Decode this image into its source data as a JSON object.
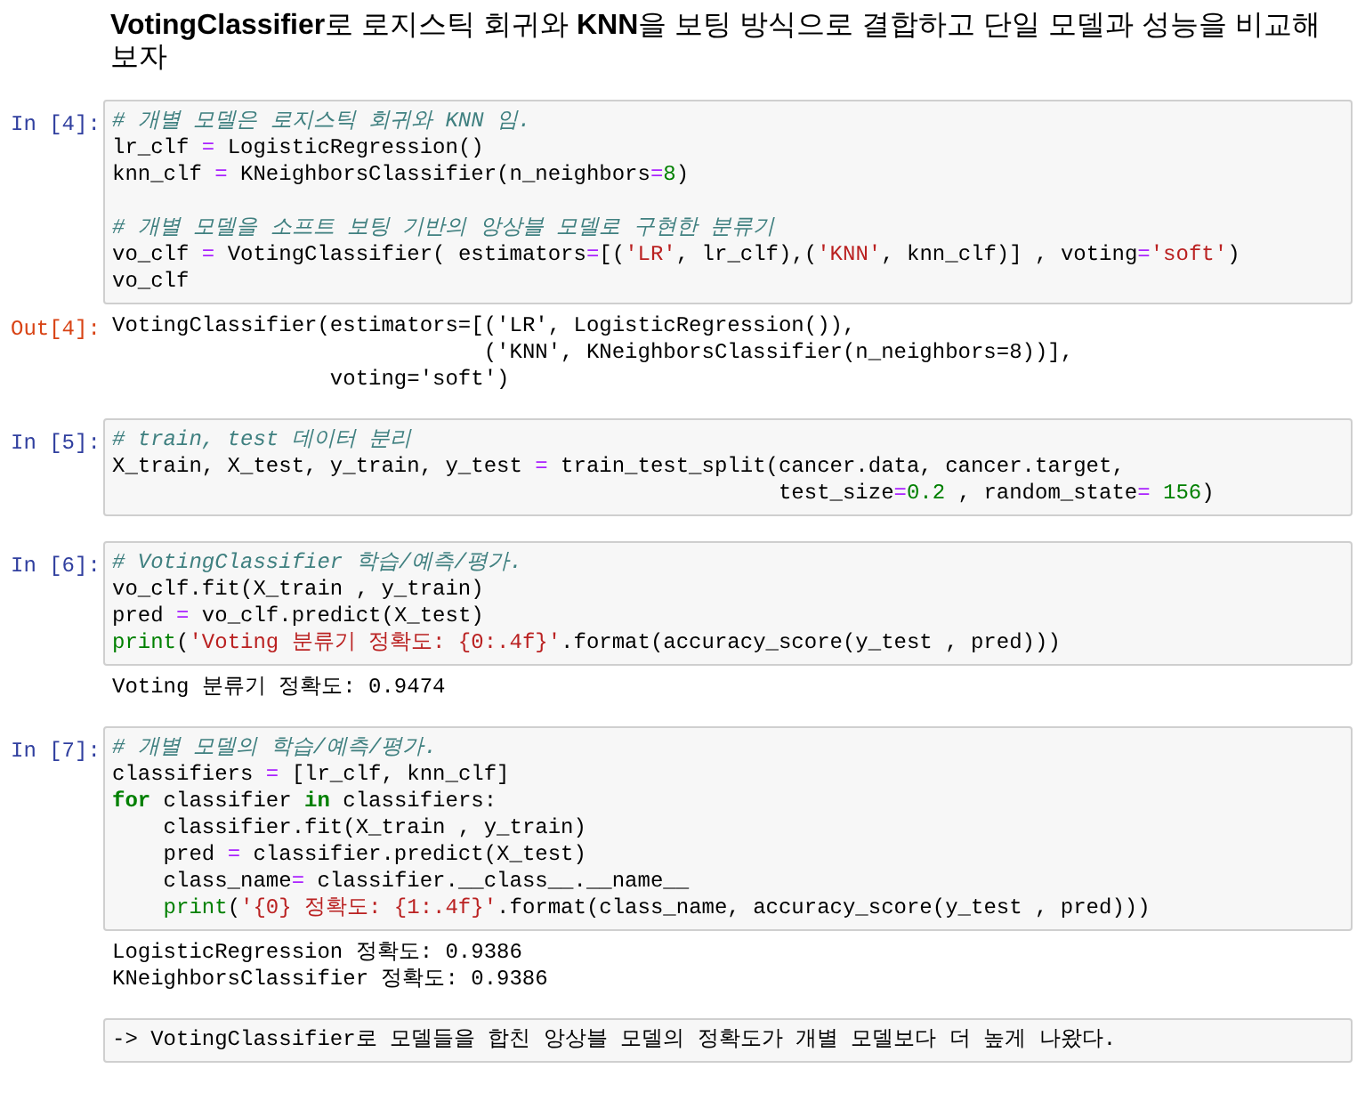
{
  "heading": "**VotingClassifier**로 로지스틱 회귀와 **KNN**을 보팅 방식으로 결합하고 단일 모델과 성능을 비교해 보자",
  "cells": [
    {
      "prompt": "In [4]:",
      "lines": [
        {
          "kind": "code",
          "tokens": [
            {
              "kind": "comment",
              "text": "# 개별 모델은 로지스틱 회귀와 KNN 임."
            }
          ]
        },
        {
          "kind": "code",
          "tokens": [
            {
              "kind": "text",
              "text": "lr_clf "
            },
            {
              "kind": "op",
              "text": "="
            },
            {
              "kind": "text",
              "text": " LogisticRegression()"
            }
          ]
        },
        {
          "kind": "code",
          "tokens": [
            {
              "kind": "text",
              "text": "knn_clf "
            },
            {
              "kind": "op",
              "text": "="
            },
            {
              "kind": "text",
              "text": " KNeighborsClassifier(n_neighbors"
            },
            {
              "kind": "op",
              "text": "="
            },
            {
              "kind": "number",
              "text": "8"
            },
            {
              "kind": "text",
              "text": ")"
            }
          ]
        },
        {
          "kind": "blank"
        },
        {
          "kind": "code",
          "tokens": [
            {
              "kind": "comment",
              "text": "# 개별 모델을 소프트 보팅 기반의 앙상블 모델로 구현한 분류기"
            }
          ]
        },
        {
          "kind": "code",
          "tokens": [
            {
              "kind": "text",
              "text": "vo_clf "
            },
            {
              "kind": "op",
              "text": "="
            },
            {
              "kind": "text",
              "text": " VotingClassifier( estimators"
            },
            {
              "kind": "op",
              "text": "="
            },
            {
              "kind": "text",
              "text": "[("
            },
            {
              "kind": "string",
              "text": "'LR'"
            },
            {
              "kind": "text",
              "text": ", lr_clf),("
            },
            {
              "kind": "string",
              "text": "'KNN'"
            },
            {
              "kind": "text",
              "text": ", knn_clf)] , voting"
            },
            {
              "kind": "op",
              "text": "="
            },
            {
              "kind": "string",
              "text": "'soft'"
            },
            {
              "kind": "text",
              "text": ")"
            }
          ]
        },
        {
          "kind": "code",
          "tokens": [
            {
              "kind": "text",
              "text": "vo_clf"
            }
          ]
        }
      ],
      "output_prompt": "Out[4]:",
      "output": [
        "VotingClassifier(estimators=[('LR', LogisticRegression()),",
        "                             ('KNN', KNeighborsClassifier(n_neighbors=8))],",
        "                 voting='soft')"
      ]
    },
    {
      "prompt": "In [5]:",
      "lines": [
        {
          "kind": "code",
          "tokens": [
            {
              "kind": "comment",
              "text": "# train, test 데이터 분리"
            }
          ]
        },
        {
          "kind": "code",
          "tokens": [
            {
              "kind": "text",
              "text": "X_train, X_test, y_train, y_test "
            },
            {
              "kind": "op",
              "text": "="
            },
            {
              "kind": "text",
              "text": " train_test_split(cancer.data, cancer.target,"
            }
          ]
        },
        {
          "kind": "code",
          "tokens": [
            {
              "kind": "text",
              "text": "                                                    test_size"
            },
            {
              "kind": "op",
              "text": "="
            },
            {
              "kind": "number",
              "text": "0.2"
            },
            {
              "kind": "text",
              "text": " , random_state"
            },
            {
              "kind": "op",
              "text": "="
            },
            {
              "kind": "number",
              "text": " 156"
            },
            {
              "kind": "text",
              "text": ")"
            }
          ]
        }
      ]
    },
    {
      "prompt": "In [6]:",
      "lines": [
        {
          "kind": "code",
          "tokens": [
            {
              "kind": "comment",
              "text": "# VotingClassifier 학습/예측/평가."
            }
          ]
        },
        {
          "kind": "code",
          "tokens": [
            {
              "kind": "text",
              "text": "vo_clf.fit(X_train , y_train)"
            }
          ]
        },
        {
          "kind": "code",
          "tokens": [
            {
              "kind": "text",
              "text": "pred "
            },
            {
              "kind": "op",
              "text": "="
            },
            {
              "kind": "text",
              "text": " vo_clf.predict(X_test)"
            }
          ]
        },
        {
          "kind": "code",
          "tokens": [
            {
              "kind": "builtin",
              "text": "print"
            },
            {
              "kind": "text",
              "text": "("
            },
            {
              "kind": "string",
              "text": "'Voting 분류기 정확도: {0:.4f}'"
            },
            {
              "kind": "text",
              "text": ".format(accuracy_score(y_test , pred)))"
            }
          ]
        }
      ],
      "output": [
        "Voting 분류기 정확도: 0.9474"
      ]
    },
    {
      "prompt": "In [7]:",
      "lines": [
        {
          "kind": "code",
          "tokens": [
            {
              "kind": "comment",
              "text": "# 개별 모델의 학습/예측/평가."
            }
          ]
        },
        {
          "kind": "code",
          "tokens": [
            {
              "kind": "text",
              "text": "classifiers "
            },
            {
              "kind": "op",
              "text": "="
            },
            {
              "kind": "text",
              "text": " [lr_clf, knn_clf]"
            }
          ]
        },
        {
          "kind": "code",
          "tokens": [
            {
              "kind": "keyword",
              "text": "for"
            },
            {
              "kind": "text",
              "text": " classifier "
            },
            {
              "kind": "keyword",
              "text": "in"
            },
            {
              "kind": "text",
              "text": " classifiers:"
            }
          ]
        },
        {
          "kind": "code",
          "tokens": [
            {
              "kind": "text",
              "text": "    classifier.fit(X_train , y_train)"
            }
          ]
        },
        {
          "kind": "code",
          "tokens": [
            {
              "kind": "text",
              "text": "    pred "
            },
            {
              "kind": "op",
              "text": "="
            },
            {
              "kind": "text",
              "text": " classifier.predict(X_test)"
            }
          ]
        },
        {
          "kind": "code",
          "tokens": [
            {
              "kind": "text",
              "text": "    class_name"
            },
            {
              "kind": "op",
              "text": "="
            },
            {
              "kind": "text",
              "text": " classifier.__class__.__name__"
            }
          ]
        },
        {
          "kind": "code",
          "tokens": [
            {
              "kind": "builtin",
              "text": "    print"
            },
            {
              "kind": "text",
              "text": "("
            },
            {
              "kind": "string",
              "text": "'{0} 정확도: {1:.4f}'"
            },
            {
              "kind": "text",
              "text": ".format(class_name, accuracy_score(y_test , pred)))"
            }
          ]
        }
      ],
      "output": [
        "LogisticRegression 정확도: 0.9386",
        "KNeighborsClassifier 정확도: 0.9386"
      ]
    },
    {
      "lines": [
        {
          "kind": "code",
          "tokens": [
            {
              "kind": "text",
              "text": "-> VotingClassifier로 모델들을 합친 앙상블 모델의 정확도가 개별 모델보다 더 높게 나왔다."
            }
          ]
        }
      ]
    }
  ]
}
